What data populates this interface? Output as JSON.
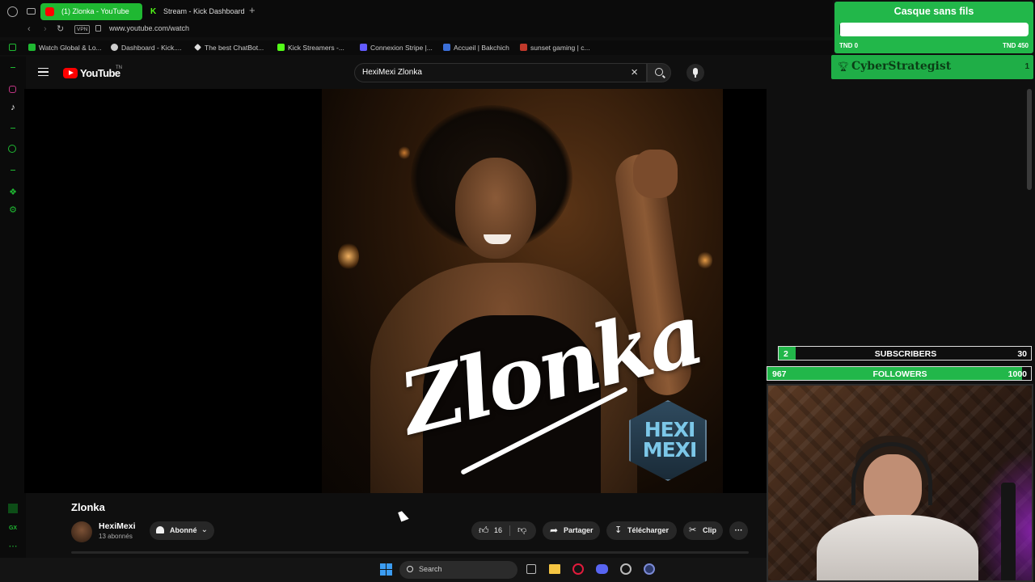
{
  "browser": {
    "tabs": [
      {
        "label": "(1) Zlonka - YouTube",
        "active": true
      },
      {
        "label": "Stream - Kick Dashboard",
        "active": false
      }
    ],
    "vpn_label": "VPN",
    "url": "www.youtube.com/watch",
    "bookmarks": [
      "Watch Global & Lo...",
      "Dashboard - Kick....",
      "The best ChatBot...",
      "Kick Streamers -...",
      "Connexion Stripe |...",
      "Accueil | Bakchich",
      "sunset gaming | c..."
    ]
  },
  "youtube": {
    "logo_text": "YouTube",
    "logo_region": "TN",
    "search_value": "HexiMexi Zlonka",
    "video": {
      "title_overlay": "Zlonka",
      "watermark": "HEXI MEXI"
    },
    "video_title": "Zlonka",
    "channel_name": "HexiMexi",
    "subscribers": "13 abonnés",
    "subscribe_label": "Abonné",
    "likes": "16",
    "share_label": "Partager",
    "download_label": "Télécharger",
    "clip_label": "Clip",
    "more_label": "···"
  },
  "taskbar": {
    "search_label": "Search"
  },
  "overlays": {
    "goal": {
      "title": "Casque sans fils",
      "min": "TND 0",
      "max": "TND 450",
      "progress": 0.005
    },
    "top_supporter": {
      "name": "CyberStrategist",
      "count": "1"
    },
    "subscribers": {
      "current": "2",
      "label": "SUBSCRIBERS",
      "goal": "30",
      "progress": 0.067
    },
    "followers": {
      "current": "967",
      "label": "FOLLOWERS",
      "goal": "1000",
      "progress": 0.967
    }
  },
  "colors": {
    "overlay_green": "#22b74a",
    "youtube_red": "#ff0000",
    "opera_green": "#1fb832"
  }
}
